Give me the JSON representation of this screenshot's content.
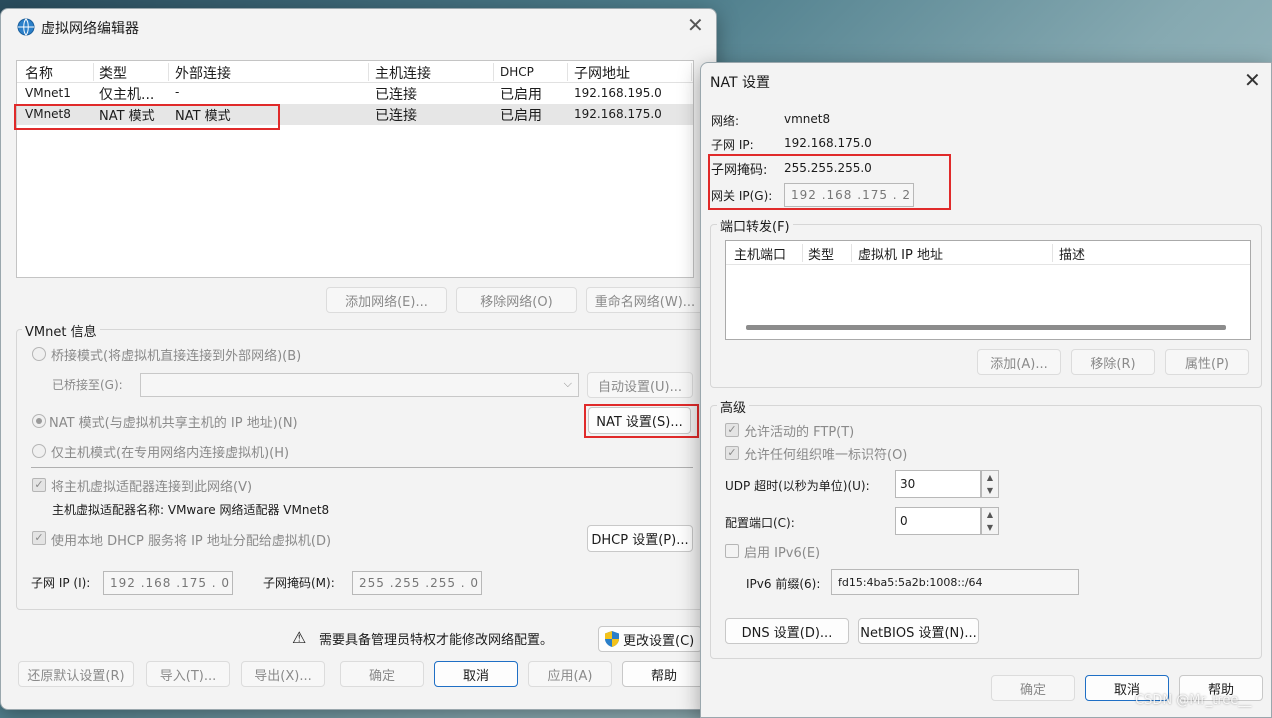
{
  "vne": {
    "title": "虚拟网络编辑器",
    "columns": [
      "名称",
      "类型",
      "外部连接",
      "主机连接",
      "DHCP",
      "子网地址"
    ],
    "rows": [
      [
        "VMnet1",
        "仅主机...",
        "-",
        "已连接",
        "已启用",
        "192.168.195.0"
      ],
      [
        "VMnet8",
        "NAT 模式",
        "NAT 模式",
        "已连接",
        "已启用",
        "192.168.175.0"
      ]
    ],
    "add_network": "添加网络(E)...",
    "remove_network": "移除网络(O)",
    "rename_network": "重命名网络(W)...",
    "vmnet_info": "VMnet 信息",
    "bridged": "桥接模式(将虚拟机直接连接到外部网络)(B)",
    "bridged_to": "已桥接至(G):",
    "auto_settings": "自动设置(U)...",
    "nat_mode": "NAT 模式(与虚拟机共享主机的 IP 地址)(N)",
    "nat_settings": "NAT 设置(S)...",
    "host_only": "仅主机模式(在专用网络内连接虚拟机)(H)",
    "connect_adapter": "将主机虚拟适配器连接到此网络(V)",
    "adapter_name": "主机虚拟适配器名称: VMware 网络适配器 VMnet8",
    "use_dhcp": "使用本地 DHCP 服务将 IP 地址分配给虚拟机(D)",
    "dhcp_settings": "DHCP 设置(P)...",
    "subnet_ip_label": "子网 IP (I):",
    "subnet_ip": "192 .168 .175 .  0",
    "subnet_mask_label": "子网掩码(M):",
    "subnet_mask": "255 .255 .255 .  0",
    "admin_warning": "需要具备管理员特权才能修改网络配置。",
    "change_settings": "更改设置(C)",
    "restore_defaults": "还原默认设置(R)",
    "import": "导入(T)...",
    "export": "导出(X)...",
    "ok": "确定",
    "cancel": "取消",
    "apply": "应用(A)",
    "help": "帮助"
  },
  "nat": {
    "title": "NAT 设置",
    "network_label": "网络:",
    "network": "vmnet8",
    "subnet_ip_label": "子网 IP:",
    "subnet_ip": "192.168.175.0",
    "subnet_mask_label": "子网掩码:",
    "subnet_mask": "255.255.255.0",
    "gateway_label": "网关 IP(G):",
    "gateway": "192 .168 .175 .  2",
    "port_forwarding": "端口转发(F)",
    "pf_columns": [
      "主机端口",
      "类型",
      "虚拟机 IP 地址",
      "描述"
    ],
    "add": "添加(A)...",
    "remove": "移除(R)",
    "properties": "属性(P)",
    "advanced": "高级",
    "allow_ftp": "允许活动的 FTP(T)",
    "allow_oui": "允许任何组织唯一标识符(O)",
    "udp_timeout_label": "UDP 超时(以秒为单位)(U):",
    "udp_timeout": "30",
    "config_port_label": "配置端口(C):",
    "config_port": "0",
    "enable_ipv6": "启用 IPv6(E)",
    "ipv6_prefix_label": "IPv6 前缀(6):",
    "ipv6_prefix": "fd15:4ba5:5a2b:1008::/64",
    "dns_settings": "DNS 设置(D)...",
    "netbios_settings": "NetBIOS 设置(N)...",
    "ok": "确定",
    "cancel": "取消",
    "help": "帮助"
  },
  "watermark": "CSDN @Mr_tree__",
  "colors": {
    "highlight": "#e02a2a",
    "accent": "#1f6fc5"
  }
}
